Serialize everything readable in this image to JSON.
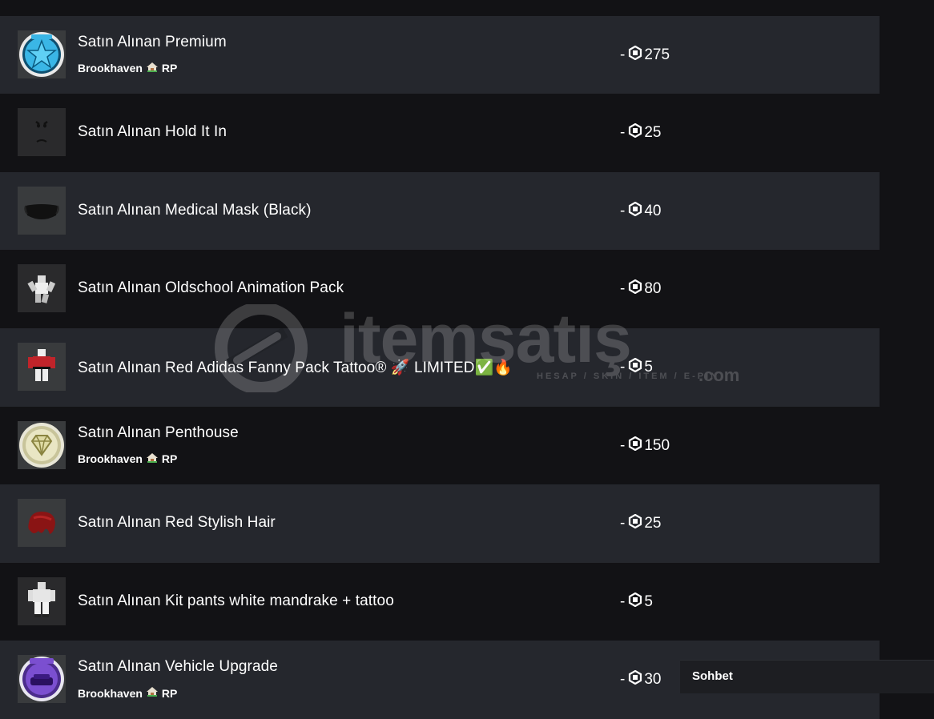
{
  "transactions": [
    {
      "title": "",
      "subtitle": "",
      "price": ""
    },
    {
      "title": "Satın Alınan Premium",
      "subtitle": "Brookhaven",
      "subtitle_suffix": "RP",
      "price": "275",
      "icon": "premium-star-badge"
    },
    {
      "title": "Satın Alınan Hold It In",
      "price": "25",
      "icon": "face"
    },
    {
      "title": "Satın Alınan Medical Mask (Black)",
      "price": "40",
      "icon": "mask"
    },
    {
      "title": "Satın Alınan Oldschool Animation Pack",
      "price": "80",
      "icon": "avatar-animation"
    },
    {
      "title": "Satın Alınan Red Adidas Fanny Pack Tattoo® 🚀 LIMITED✅🔥",
      "price": "5",
      "icon": "shirt-avatar"
    },
    {
      "title": "Satın Alınan Penthouse",
      "subtitle": "Brookhaven",
      "subtitle_suffix": "RP",
      "price": "150",
      "icon": "diamond-badge"
    },
    {
      "title": "Satın Alınan Red Stylish Hair",
      "price": "25",
      "icon": "hair"
    },
    {
      "title": "Satın Alınan Kit pants white mandrake + tattoo",
      "price": "5",
      "icon": "pants-avatar"
    },
    {
      "title": "Satın Alınan Vehicle Upgrade",
      "subtitle": "Brookhaven",
      "subtitle_suffix": "RP",
      "price": "30",
      "icon": "vehicle-badge"
    }
  ],
  "price_prefix": "-",
  "watermark": {
    "brand": "itemsatış",
    "tagline": "HESAP / SKIN / ITEM / E-PIN",
    "domain": ".com"
  },
  "chat": {
    "label": "Sohbet"
  },
  "colors": {
    "row_alt": "#25272d",
    "row": "#121215",
    "thumb_bg": "#393b3d"
  }
}
